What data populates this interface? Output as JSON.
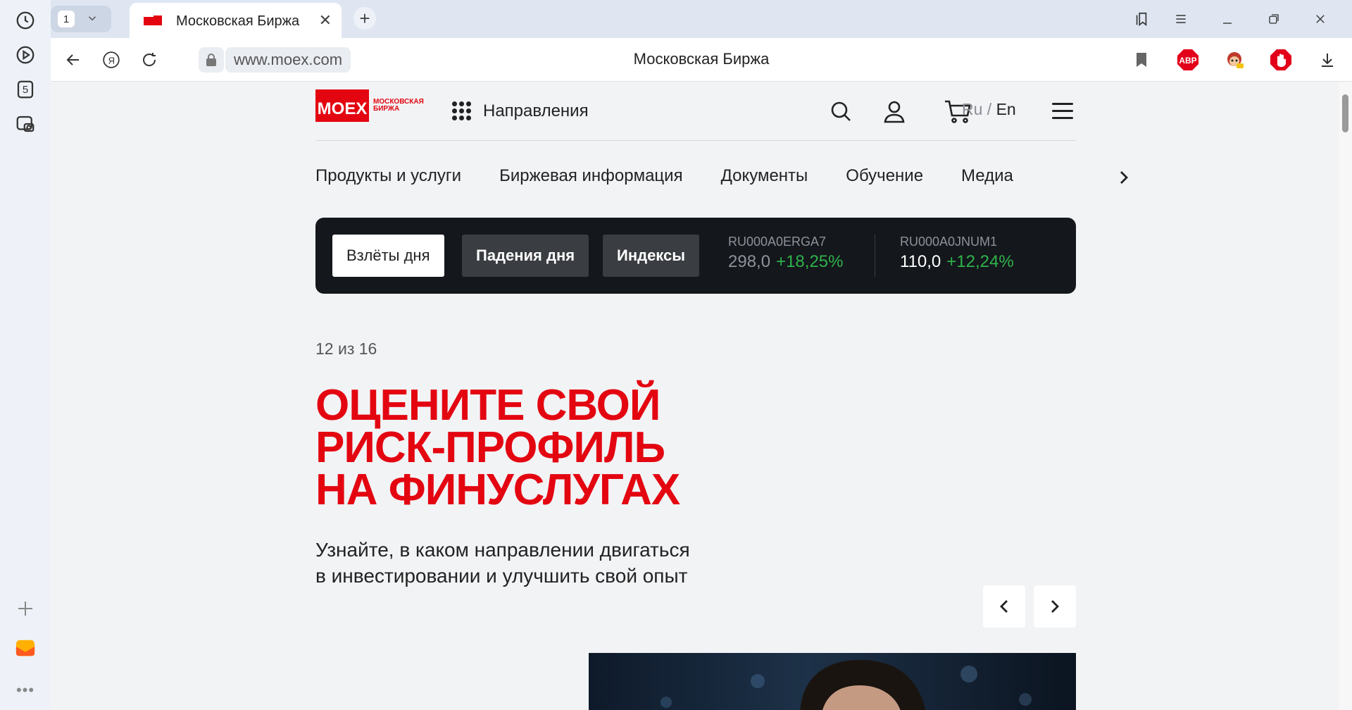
{
  "browser": {
    "tab_count": "1",
    "tab_title": "Московская Биржа",
    "url": "www.moex.com",
    "page_title": "Московская Биржа",
    "sidebar_badge": "5"
  },
  "site": {
    "logo_text": "MOEX",
    "logo_sub_1": "МОСКОВСКАЯ",
    "logo_sub_2": "БИРЖА",
    "directions_label": "Направления",
    "lang_ru": "Ru",
    "lang_sep": " / ",
    "lang_en": "En",
    "nav": [
      "Продукты и услуги",
      "Биржевая информация",
      "Документы",
      "Обучение",
      "Медиа"
    ],
    "ticker": {
      "buttons": [
        "Взлёты дня",
        "Падения дня",
        "Индексы"
      ],
      "items": [
        {
          "code": "RU000A0ERGA7",
          "price": "298,0",
          "change": "+18,25%"
        },
        {
          "code": "RU000A0JNUM1",
          "price": "110,0",
          "change": "+12,24%"
        }
      ]
    },
    "slider_counter": "12 из 16",
    "headline_1": "Оцените свой",
    "headline_2": "риск-профиль",
    "headline_3": "на финуслугах",
    "subtext_1": "Узнайте, в каком направлении двигаться",
    "subtext_2": "в инвестировании и улучшить свой опыт"
  },
  "colors": {
    "brand_red": "#e30611",
    "positive_green": "#2fb34b",
    "ticker_bg": "#14171c"
  }
}
